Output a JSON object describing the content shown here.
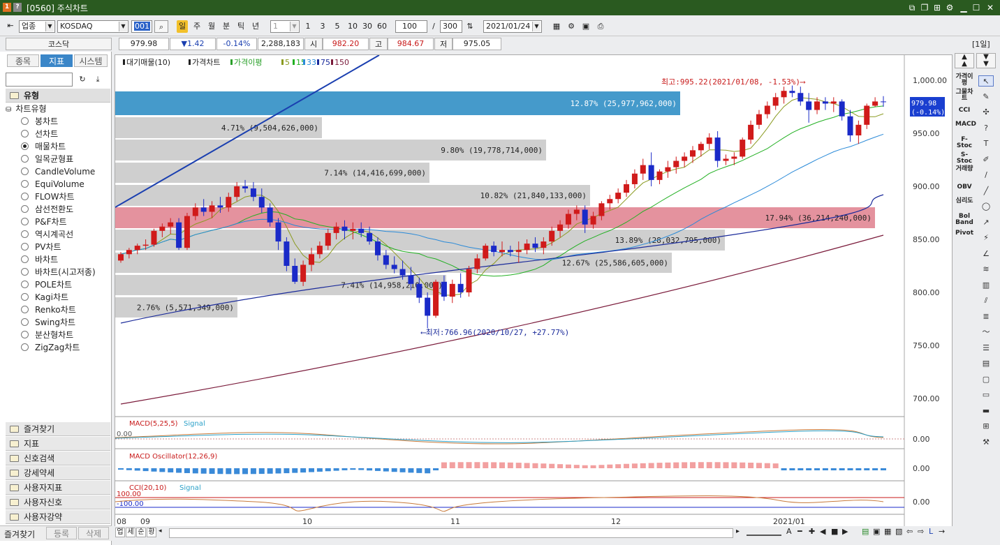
{
  "window": {
    "badge1": "1",
    "badge2": "?",
    "title": "[0560] 주식차트"
  },
  "toolbar": {
    "market": "업종",
    "index": "KOSDAQ",
    "code": "001",
    "periods": [
      "일",
      "주",
      "월",
      "분",
      "틱",
      "년"
    ],
    "interval": "1",
    "quick": [
      "1",
      "3",
      "5",
      "10",
      "30",
      "60"
    ],
    "count": "100",
    "total": "300",
    "date": "2021/01/24",
    "period_tag": "[1일]"
  },
  "quote": {
    "name": "코스닥",
    "price": "979.98",
    "change": "▼1.42",
    "rate": "-0.14%",
    "volume": "2,288,183",
    "open_label": "시",
    "open": "982.20",
    "high_label": "고",
    "high": "984.67",
    "low_label": "저",
    "low": "975.05"
  },
  "sidebar": {
    "tabs": [
      "종목",
      "지표",
      "시스템"
    ],
    "active_tab": 1,
    "group": "유형",
    "tree": "차트유형",
    "types": [
      "봉차트",
      "선차트",
      "매물차트",
      "일목균형표",
      "CandleVolume",
      "EquiVolume",
      "FLOW차트",
      "삼선전환도",
      "P&F차트",
      "역시계곡선",
      "PV차트",
      "바차트",
      "바차트(시고저종)",
      "POLE차트",
      "Kagi차트",
      "Renko차트",
      "Swing차트",
      "분산형차트",
      "ZigZag차트"
    ],
    "selected": 2,
    "sections": [
      "즐겨찾기",
      "지표",
      "신호검색",
      "강세약세",
      "사용자지표",
      "사용자신호",
      "사용자강약"
    ],
    "bottom": [
      "즐겨찾기",
      "등록",
      "삭제"
    ]
  },
  "chart": {
    "legend": [
      "대기매물(10)",
      "가격차트",
      "가격이평",
      "5",
      "15",
      "33",
      "75",
      "150"
    ],
    "high_note": "최고:995.22(2021/01/08, -1.53%)⟶",
    "low_note": "⟵최저:766.96(2020/10/27, +27.77%)",
    "price_tag": "979.98",
    "price_tag2": "(-0.14%)",
    "yticks": [
      "1,000.00",
      "950.00",
      "900.00",
      "850.00",
      "800.00",
      "750.00",
      "700.00"
    ],
    "xticks": [
      "08",
      "09",
      "10",
      "11",
      "12",
      "2021/01"
    ],
    "volume_bands": [
      {
        "label": "12.87% (25,977,962,000)",
        "pct": 12.87,
        "color": "#3b95c8"
      },
      {
        "label": "4.71% (9,504,626,000)",
        "pct": 4.71,
        "color": "#cfcfcf"
      },
      {
        "label": "9.80% (19,778,714,000)",
        "pct": 9.8,
        "color": "#cfcfcf"
      },
      {
        "label": "7.14% (14,416,699,000)",
        "pct": 7.14,
        "color": "#cfcfcf"
      },
      {
        "label": "10.82% (21,840,133,000)",
        "pct": 10.82,
        "color": "#cfcfcf"
      },
      {
        "label": "17.94% (36,214,240,000)",
        "pct": 17.94,
        "color": "#e38c99"
      },
      {
        "label": "13.89% (28,032,795,000)",
        "pct": 13.89,
        "color": "#cfcfcf"
      },
      {
        "label": "12.67% (25,586,605,000)",
        "pct": 12.67,
        "color": "#cfcfcf"
      },
      {
        "label": "7.41% (14,958,210,000)",
        "pct": 7.41,
        "color": "#cfcfcf"
      },
      {
        "label": "2.76% (5,571,349,000)",
        "pct": 2.76,
        "color": "#cfcfcf"
      }
    ],
    "macd_label": "MACD(5,25,5)",
    "macd_signal": "Signal",
    "macd_zero": "0.00",
    "macd_left": "0.00",
    "osc_label": "MACD Oscillator(12,26,9)",
    "osc_zero": "0.00",
    "cci_label": "CCI(20,10)",
    "cci_signal": "Signal",
    "cci_zero": "0.00",
    "cci_p100": "100.00",
    "cci_m100": "-100.00"
  },
  "right_indicators": [
    "가격이평",
    "그물차트",
    "CCI",
    "MACD",
    "F-Stoc",
    "S-Stoc",
    "거래량",
    "OBV",
    "심리도",
    "Bol Band",
    "Pivot"
  ],
  "bottom_tabs": [
    "업",
    "세",
    "순",
    "황"
  ],
  "chart_data": {
    "type": "candlestick",
    "ylim": [
      690,
      1010
    ],
    "candles": [
      [
        830,
        838,
        828,
        836
      ],
      [
        836,
        842,
        832,
        840
      ],
      [
        840,
        846,
        836,
        844
      ],
      [
        844,
        850,
        840,
        845
      ],
      [
        845,
        860,
        843,
        858
      ],
      [
        858,
        865,
        852,
        862
      ],
      [
        862,
        870,
        855,
        866
      ],
      [
        866,
        870,
        840,
        842
      ],
      [
        842,
        875,
        840,
        872
      ],
      [
        872,
        884,
        868,
        880
      ],
      [
        880,
        888,
        872,
        876
      ],
      [
        876,
        886,
        870,
        882
      ],
      [
        882,
        890,
        875,
        880
      ],
      [
        880,
        894,
        876,
        890
      ],
      [
        890,
        904,
        886,
        900
      ],
      [
        900,
        906,
        894,
        898
      ],
      [
        898,
        904,
        886,
        890
      ],
      [
        890,
        898,
        875,
        880
      ],
      [
        880,
        884,
        862,
        866
      ],
      [
        866,
        870,
        840,
        848
      ],
      [
        848,
        852,
        820,
        825
      ],
      [
        825,
        832,
        808,
        810
      ],
      [
        810,
        830,
        806,
        826
      ],
      [
        826,
        842,
        820,
        836
      ],
      [
        836,
        848,
        832,
        844
      ],
      [
        844,
        860,
        840,
        856
      ],
      [
        856,
        866,
        850,
        862
      ],
      [
        862,
        868,
        850,
        858
      ],
      [
        858,
        866,
        850,
        860
      ],
      [
        860,
        866,
        852,
        856
      ],
      [
        856,
        862,
        845,
        848
      ],
      [
        848,
        852,
        830,
        835
      ],
      [
        835,
        840,
        822,
        826
      ],
      [
        826,
        834,
        818,
        822
      ],
      [
        822,
        830,
        812,
        816
      ],
      [
        816,
        824,
        802,
        808
      ],
      [
        808,
        814,
        790,
        795
      ],
      [
        795,
        800,
        766,
        778
      ],
      [
        778,
        812,
        776,
        810
      ],
      [
        810,
        816,
        792,
        796
      ],
      [
        796,
        812,
        790,
        808
      ],
      [
        808,
        818,
        795,
        800
      ],
      [
        800,
        825,
        796,
        822
      ],
      [
        822,
        836,
        818,
        832
      ],
      [
        832,
        846,
        830,
        844
      ],
      [
        844,
        848,
        834,
        838
      ],
      [
        838,
        848,
        834,
        840
      ],
      [
        840,
        844,
        834,
        838
      ],
      [
        838,
        848,
        828,
        840
      ],
      [
        840,
        850,
        836,
        846
      ],
      [
        846,
        852,
        838,
        842
      ],
      [
        842,
        852,
        836,
        848
      ],
      [
        848,
        862,
        844,
        858
      ],
      [
        858,
        868,
        852,
        864
      ],
      [
        864,
        878,
        860,
        874
      ],
      [
        874,
        882,
        868,
        878
      ],
      [
        878,
        882,
        856,
        864
      ],
      [
        864,
        876,
        860,
        872
      ],
      [
        872,
        886,
        868,
        884
      ],
      [
        884,
        892,
        878,
        888
      ],
      [
        888,
        898,
        884,
        894
      ],
      [
        894,
        906,
        890,
        902
      ],
      [
        902,
        916,
        898,
        912
      ],
      [
        912,
        926,
        906,
        920
      ],
      [
        920,
        932,
        900,
        906
      ],
      [
        906,
        916,
        902,
        914
      ],
      [
        914,
        924,
        908,
        918
      ],
      [
        918,
        928,
        912,
        924
      ],
      [
        924,
        932,
        918,
        928
      ],
      [
        928,
        938,
        922,
        934
      ],
      [
        934,
        942,
        928,
        940
      ],
      [
        940,
        950,
        935,
        946
      ],
      [
        946,
        952,
        918,
        924
      ],
      [
        924,
        930,
        920,
        926
      ],
      [
        926,
        932,
        920,
        928
      ],
      [
        928,
        946,
        926,
        944
      ],
      [
        944,
        962,
        940,
        958
      ],
      [
        958,
        972,
        954,
        968
      ],
      [
        968,
        980,
        964,
        976
      ],
      [
        976,
        988,
        972,
        984
      ],
      [
        984,
        994,
        978,
        990
      ],
      [
        990,
        995,
        984,
        988
      ],
      [
        988,
        994,
        976,
        980
      ],
      [
        980,
        988,
        960,
        972
      ],
      [
        972,
        984,
        968,
        980
      ],
      [
        980,
        984,
        972,
        978
      ],
      [
        978,
        984,
        970,
        980
      ],
      [
        980,
        982,
        962,
        966
      ],
      [
        966,
        972,
        942,
        948
      ],
      [
        948,
        962,
        940,
        958
      ],
      [
        958,
        978,
        954,
        976
      ],
      [
        976,
        984,
        975,
        980
      ],
      [
        980,
        985,
        975,
        979.98
      ]
    ]
  }
}
